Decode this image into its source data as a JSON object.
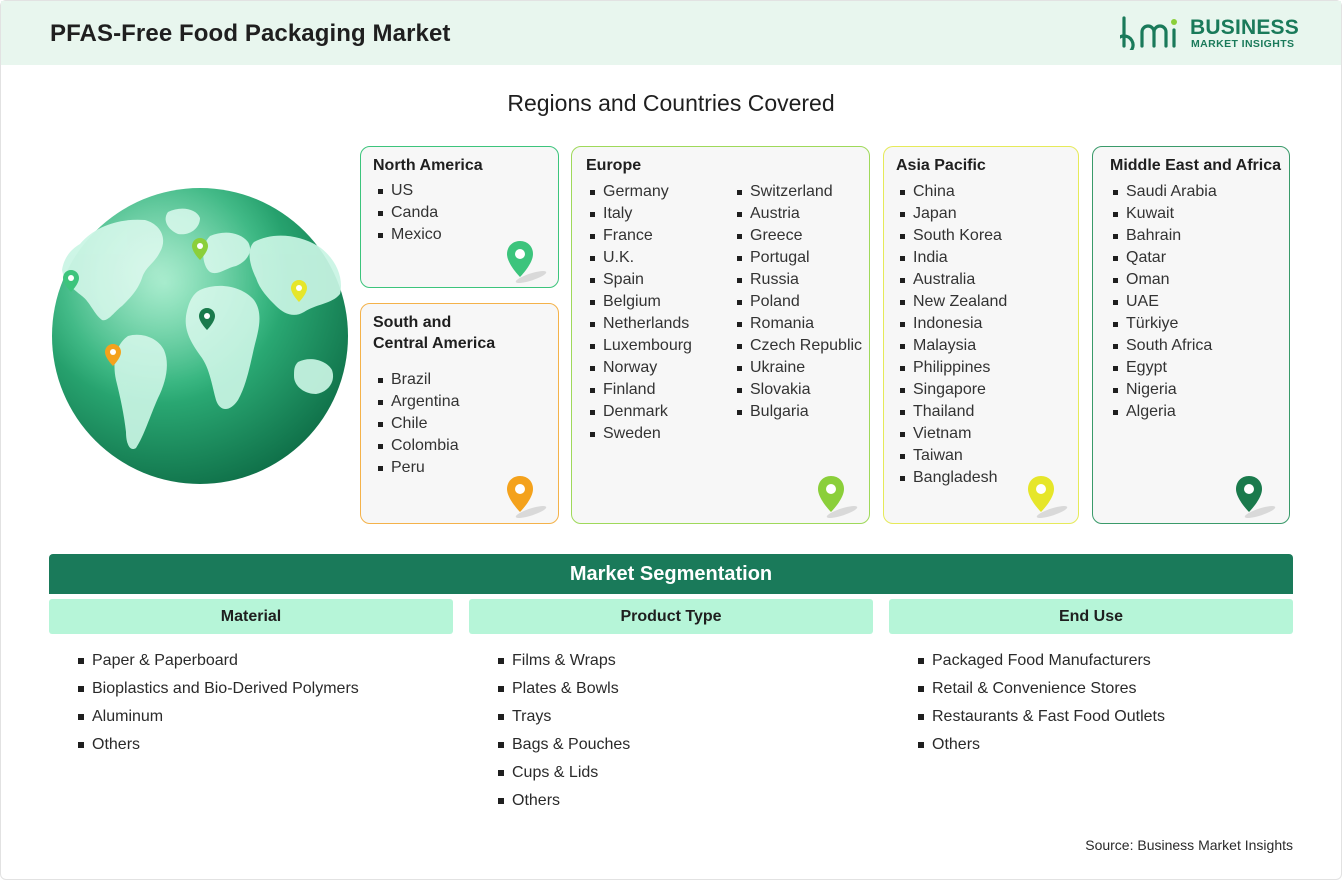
{
  "header": {
    "title": "PFAS-Free Food Packaging Market",
    "logo": {
      "mark": "bmi",
      "line1": "BUSINESS",
      "line2": "MARKET INSIGHTS",
      "color": "#1a7a5a"
    }
  },
  "regions": {
    "title": "Regions and Countries Covered",
    "north_america": {
      "title": "North America",
      "items": [
        "US",
        "Canda",
        "Mexico"
      ],
      "color": "#3cc47c"
    },
    "south_america": {
      "title_line1": "South and",
      "title_line2": "Central America",
      "items": [
        "Brazil",
        "Argentina",
        "Chile",
        "Colombia",
        "Peru"
      ],
      "color": "#f4a21c"
    },
    "europe": {
      "title": "Europe",
      "col1": [
        "Germany",
        "Italy",
        "France",
        "U.K.",
        "Spain",
        "Belgium",
        "Netherlands",
        "Luxembourg",
        "Norway",
        "Finland",
        "Denmark",
        "Sweden"
      ],
      "col2": [
        "Switzerland",
        "Austria",
        "Greece",
        "Portugal",
        "Russia",
        "Poland",
        "Romania",
        "Czech Republic",
        "Ukraine",
        "Slovakia",
        "Bulgaria"
      ],
      "color": "#8bcf3a"
    },
    "asia_pacific": {
      "title": "Asia Pacific",
      "items": [
        "China",
        "Japan",
        "South Korea",
        "India",
        "Australia",
        "New Zealand",
        "Indonesia",
        "Malaysia",
        "Philippines",
        "Singapore",
        "Thailand",
        "Vietnam",
        "Taiwan",
        "Bangladesh"
      ],
      "color": "#e6e62a"
    },
    "mea": {
      "title": "Middle East and Africa",
      "items": [
        "Saudi Arabia",
        "Kuwait",
        "Bahrain",
        "Qatar",
        "Oman",
        "UAE",
        "Türkiye",
        "South Africa",
        "Egypt",
        "Nigeria",
        "Algeria"
      ],
      "color": "#1a7a4c"
    }
  },
  "segmentation": {
    "title": "Market Segmentation",
    "material": {
      "title": "Material",
      "items": [
        "Paper & Paperboard",
        "Bioplastics and Bio-Derived Polymers",
        "Aluminum",
        "Others"
      ]
    },
    "product_type": {
      "title": "Product Type",
      "items": [
        "Films & Wraps",
        "Plates & Bowls",
        "Trays",
        "Bags & Pouches",
        "Cups & Lids",
        "Others"
      ]
    },
    "end_use": {
      "title": "End Use",
      "items": [
        "Packaged Food Manufacturers",
        "Retail & Convenience Stores",
        "Restaurants & Fast Food Outlets",
        "Others"
      ]
    }
  },
  "source": "Source: Business Market Insights"
}
